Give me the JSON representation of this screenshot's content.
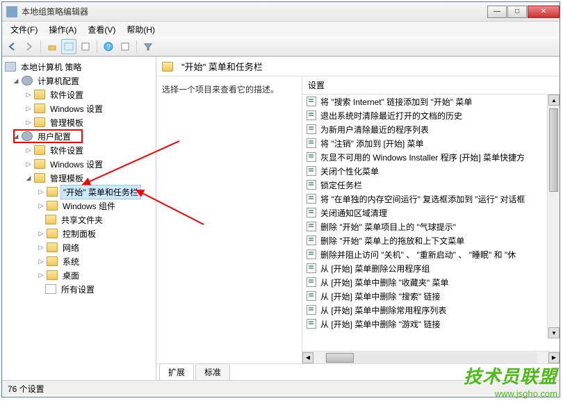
{
  "window": {
    "title": "本地组策略编辑器"
  },
  "menu": {
    "file": "文件(F)",
    "action": "操作(A)",
    "view": "查看(V)",
    "help": "帮助(H)"
  },
  "tree": {
    "root": "本地计算机 策略",
    "computer_config": "计算机配置",
    "cc_software": "软件设置",
    "cc_windows": "Windows 设置",
    "cc_admin": "管理模板",
    "user_config": "用户配置",
    "uc_software": "软件设置",
    "uc_windows": "Windows 设置",
    "uc_admin": "管理模板",
    "start_taskbar": "\"开始\" 菜单和任务栏",
    "win_components": "Windows 组件",
    "shared_folders": "共享文件夹",
    "control_panel": "控制面板",
    "network": "网络",
    "system": "系统",
    "desktop": "桌面",
    "all_settings": "所有设置"
  },
  "right": {
    "header": "\"开始\" 菜单和任务栏",
    "description": "选择一个项目来查看它的描述。",
    "settings_label": "设置"
  },
  "settings": [
    "将 \"搜索 Internet\" 链接添加到 \"开始\" 菜单",
    "退出系统时清除最近打开的文档的历史",
    "为新用户清除最近的程序列表",
    "将 \"注销\" 添加到 [开始] 菜单",
    "灰显不可用的 Windows Installer 程序 [开始] 菜单快捷方",
    "关闭个性化菜单",
    "锁定任务栏",
    "将 \"在单独的内存空间运行\" 复选框添加到 \"运行\" 对话框",
    "关闭通知区域清理",
    "删除 \"开始\" 菜单项目上的 \"气球提示\"",
    "删除 \"开始\" 菜单上的拖放和上下文菜单",
    "删除并阻止访问 \"关机\" 、 \"重新启动\" 、 \"睡眠\" 和 \"休",
    "从 [开始] 菜单删除公用程序组",
    "从 [开始] 菜单中删除 \"收藏夹\" 菜单",
    "从 [开始] 菜单中删除 \"搜索\" 链接",
    "从 [开始] 菜单中删除常用程序列表",
    "从 [开始] 菜单中删除 \"游戏\" 链接"
  ],
  "tabs": {
    "extended": "扩展",
    "standard": "标准"
  },
  "statusbar": "76 个设置",
  "watermark": {
    "big": "技术员联盟",
    "small": "www.jsgho.com"
  }
}
